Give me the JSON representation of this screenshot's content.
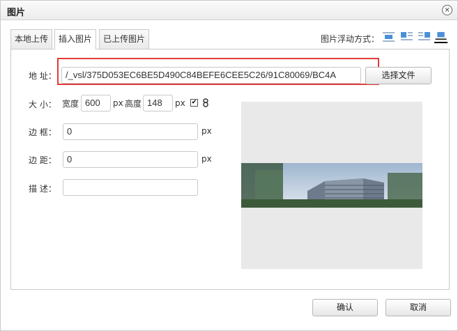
{
  "dialog": {
    "title": "图片",
    "close_icon": "×"
  },
  "tabs": [
    {
      "label": "本地上传",
      "active": false
    },
    {
      "label": "插入图片",
      "active": true
    },
    {
      "label": "已上传图片",
      "active": false
    }
  ],
  "float": {
    "label": "图片浮动方式：",
    "options": [
      "none",
      "left",
      "right",
      "center"
    ],
    "selected": "center"
  },
  "form": {
    "address_label": "地 址：",
    "address_value": "/_vsl/375D053EC6BE5D490C84BEFE6CEE5C26/91C80069/BC4A",
    "choose_file_label": "选择文件",
    "size_label": "大 小：",
    "width_label": "宽度",
    "width_value": "600",
    "width_unit": "px",
    "height_label": "高度",
    "height_value": "148",
    "height_unit": "px",
    "lock_ratio_checked": true,
    "border_label": "边 框：",
    "border_value": "0",
    "border_unit": "px",
    "margin_label": "边 距：",
    "margin_value": "0",
    "margin_unit": "px",
    "desc_label": "描 述：",
    "desc_value": ""
  },
  "footer": {
    "confirm_label": "确认",
    "cancel_label": "取消"
  },
  "colors": {
    "highlight_box": "#e53a3a",
    "preview_bg": "#e9e9e9"
  }
}
